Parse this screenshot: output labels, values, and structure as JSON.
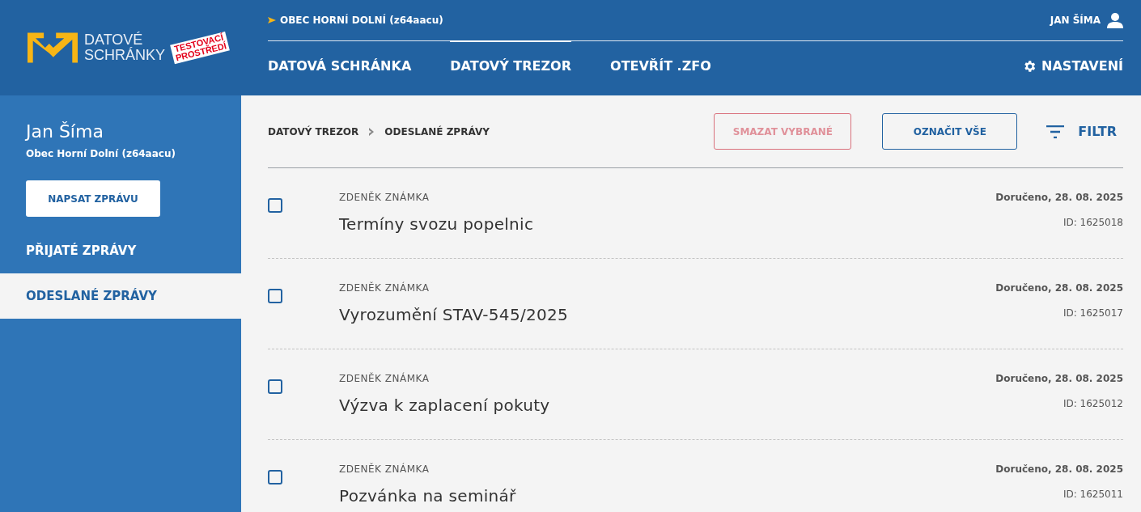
{
  "logo": {
    "line_1": "DATOVÉ",
    "line_2": "SCHRÁNKY",
    "stamp_1": "TESTOVACÍ",
    "stamp_2": "PROSTŘEDÍ"
  },
  "header": {
    "account": "OBEC HORNÍ DOLNÍ (z64aacu)",
    "user": "JAN ŠÍMA",
    "settings": "NASTAVENÍ",
    "tabs": [
      {
        "label": "DATOVÁ SCHRÁNKA",
        "selected": false
      },
      {
        "label": "DATOVÝ TREZOR",
        "selected": true
      },
      {
        "label": "OTEVŘÍT .ZFO",
        "selected": false
      }
    ]
  },
  "sidebar": {
    "name": "Jan Šíma",
    "org": "Obec Horní Dolní (z64aacu)",
    "compose": "NAPSAT ZPRÁVU",
    "items": [
      {
        "label": "PŘIJATÉ ZPRÁVY",
        "selected": false
      },
      {
        "label": "ODESLANÉ ZPRÁVY",
        "selected": true
      }
    ]
  },
  "breadcrumb": [
    "DATOVÝ TREZOR",
    "ODESLANÉ ZPRÁVY"
  ],
  "actions": {
    "delete": {
      "label": "SMAZAT VYBRANÉ",
      "disabled": true
    },
    "select_all": "OZNAČIT VŠE",
    "filter": "FILTR"
  },
  "messages": [
    {
      "checked": false,
      "sender": "ZDENĚK ZNÁMKA",
      "subject": "Termíny svozu popelnic",
      "status": "Doručeno, 28. 08. 2025",
      "id": "ID: 1625018"
    },
    {
      "checked": false,
      "sender": "ZDENĚK ZNÁMKA",
      "subject": "Vyrozumění STAV-545/2025",
      "status": "Doručeno, 28. 08. 2025",
      "id": "ID: 1625017"
    },
    {
      "checked": false,
      "sender": "ZDENĚK ZNÁMKA",
      "subject": "Výzva k zaplacení pokuty",
      "status": "Doručeno, 28. 08. 2025",
      "id": "ID: 1625012"
    },
    {
      "checked": false,
      "sender": "ZDENĚK ZNÁMKA",
      "subject": "Pozvánka na seminář",
      "status": "Doručeno, 28. 08. 2025",
      "id": "ID: 1625011"
    }
  ]
}
